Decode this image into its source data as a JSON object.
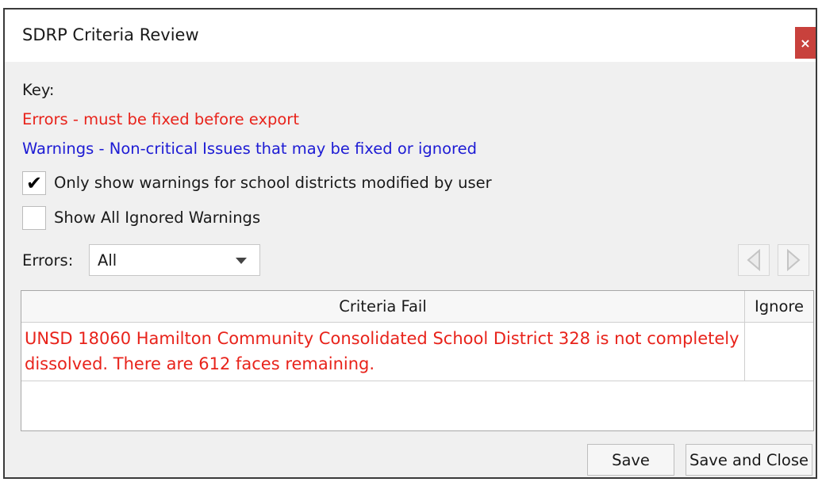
{
  "window": {
    "title": "SDRP Criteria Review",
    "close_label": "×"
  },
  "key": {
    "heading": "Key:",
    "errors": "Errors - must be fixed before export",
    "warnings": "Warnings - Non-critical Issues that may be fixed or ignored",
    "errors_color": "#e8231b",
    "warnings_color": "#1d1bd4"
  },
  "options": {
    "only_modified": {
      "label": "Only show warnings for school districts modified by user",
      "checked": true,
      "mark": "✔"
    },
    "show_ignored": {
      "label": "Show All Ignored Warnings",
      "checked": false,
      "mark": ""
    }
  },
  "filter": {
    "label": "Errors:",
    "selected": "All"
  },
  "table": {
    "columns": [
      "Criteria Fail",
      "Ignore"
    ],
    "rows": [
      {
        "criteria": "UNSD 18060 Hamilton Community Consolidated School District 328 is not completely dissolved. There are 612 faces remaining.",
        "ignore": ""
      }
    ]
  },
  "buttons": {
    "save": "Save",
    "save_close": "Save and Close"
  },
  "icons": {
    "prev": "left-triangle-icon",
    "next": "right-triangle-icon",
    "close": "close-icon"
  }
}
